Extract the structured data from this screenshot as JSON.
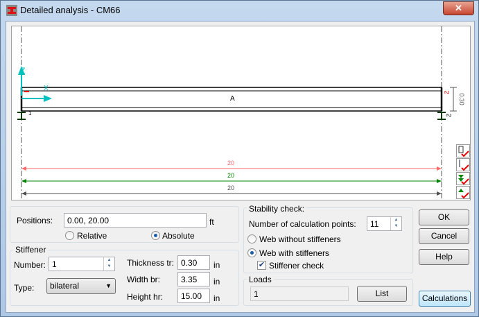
{
  "window": {
    "title": "Detailed analysis - CM66",
    "close": "✕"
  },
  "drawing": {
    "beam_label": "A",
    "node_start": "1",
    "node_end": "2",
    "height_dim": "0.30",
    "end_label": "2",
    "axis_z": "Z",
    "axis_x": "X",
    "dims": [
      {
        "value": "20",
        "color": "#ff5a5a"
      },
      {
        "value": "20",
        "color": "#008000"
      },
      {
        "value": "20",
        "color": "#505050"
      }
    ]
  },
  "positions": {
    "label": "Positions:",
    "value": "0.00, 20.00",
    "unit": "ft",
    "relative": "Relative",
    "absolute": "Absolute",
    "selected": "Absolute"
  },
  "stiffener": {
    "title": "Stiffener",
    "number_label": "Number:",
    "number": "1",
    "type_label": "Type:",
    "type": "bilateral",
    "thickness_label": "Thickness tr:",
    "thickness": "0.30",
    "width_label": "Width br:",
    "width": "3.35",
    "height_label": "Height hr:",
    "height": "15.00",
    "unit": "in"
  },
  "stability": {
    "title": "Stability check:",
    "points_label": "Number of calculation points:",
    "points": "11",
    "without": "Web without stiffeners",
    "with": "Web with stiffeners",
    "stiffener_check": "Stiffener check",
    "selected": "Web with stiffeners",
    "checked": true
  },
  "loads": {
    "title": "Loads",
    "value": "1",
    "list": "List"
  },
  "buttons": {
    "ok": "OK",
    "cancel": "Cancel",
    "help": "Help",
    "calculations": "Calculations"
  }
}
